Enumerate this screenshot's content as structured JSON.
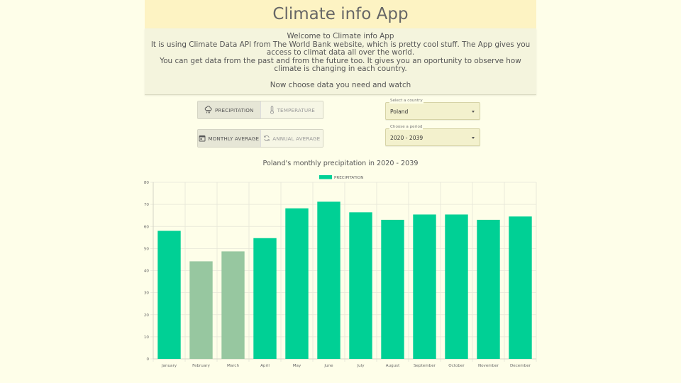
{
  "header": {
    "title": "Climate info App"
  },
  "welcome": {
    "lines": [
      "Welcome to Climate info App",
      "It is using Climate Data API from The World Bank website, which is pretty cool stuff. The App gives you access to climat data all over the world.",
      "You can get data from the past and from the future too. It gives you an oportunity to observe how climate is changing in each country."
    ],
    "cta": "Now choose data you need and watch"
  },
  "data_type_toggle": {
    "precipitation_label": "PRECIPITATION",
    "temperature_label": "TEMPERATURE",
    "selected": "precipitation"
  },
  "average_toggle": {
    "monthly_label": "MONTHLY AVERAGE",
    "annual_label": "ANNUAL AVERAGE",
    "selected": "monthly"
  },
  "country_select": {
    "label": "Select a country",
    "value": "Poland"
  },
  "period_select": {
    "label": "Choose a period",
    "value": "2020 - 2039"
  },
  "colors": {
    "bar_primary": "#00d095",
    "bar_muted": "#97c7a0",
    "header_bg": "#fdf3c3",
    "page_bg": "#fefee9"
  },
  "chart_data": {
    "type": "bar",
    "title": "Poland's monthly precipitation in 2020 - 2039",
    "legend": [
      "PRECIPITATION"
    ],
    "legend_position": "top",
    "categories": [
      "January",
      "February",
      "March",
      "April",
      "May",
      "June",
      "July",
      "August",
      "September",
      "October",
      "November",
      "December"
    ],
    "values": [
      58,
      44.2,
      48.7,
      54.7,
      68.2,
      71.2,
      66.4,
      63,
      65.4,
      65.4,
      63,
      64.5
    ],
    "muted_bars": [
      1,
      2
    ],
    "ylim": [
      0,
      80
    ],
    "yticks": [
      0,
      10,
      20,
      30,
      40,
      50,
      60,
      70,
      80
    ],
    "grid": true
  }
}
